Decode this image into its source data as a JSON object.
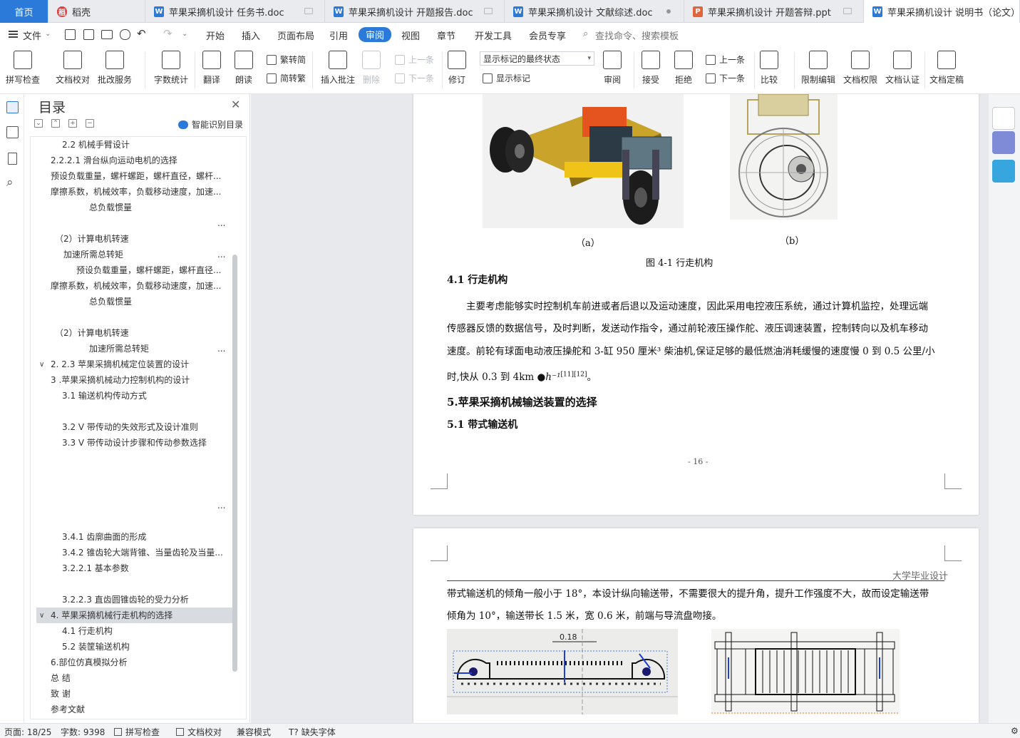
{
  "tabs": [
    {
      "label": "首页",
      "type": "home"
    },
    {
      "label": "稻壳",
      "type": "docer"
    },
    {
      "label": "苹果采摘机设计 任务书.doc",
      "type": "word"
    },
    {
      "label": "苹果采摘机设计 开题报告.doc",
      "type": "word"
    },
    {
      "label": "苹果采摘机设计 文献综述.doc",
      "type": "word"
    },
    {
      "label": "苹果采摘机设计 开题答辩.ppt",
      "type": "ppt"
    },
    {
      "label": "苹果采摘机设计 说明书（论文）",
      "type": "word",
      "active": true
    }
  ],
  "menu": {
    "file": "文件",
    "items": [
      "开始",
      "插入",
      "页面布局",
      "引用",
      "审阅",
      "视图",
      "章节",
      "开发工具",
      "会员专享"
    ],
    "active": "审阅",
    "search_placeholder": "查找命令、搜索模板"
  },
  "ribbon": {
    "spellcheck": "拼写检查",
    "doc_check": "文档校对",
    "batch_service": "批改服务",
    "word_count": "字数统计",
    "translate": "翻译",
    "read_aloud": "朗读",
    "to_traditional": "繁转简",
    "to_simplified": "简转繁",
    "insert_comment": "插入批注",
    "delete": "删除",
    "prev": "上一条",
    "next": "下一条",
    "track": "修订",
    "markup_select": "显示标记的最终状态",
    "show_markup": "显示标记",
    "review": "审阅",
    "accept": "接受",
    "reject": "拒绝",
    "prev2": "上一条",
    "next2": "下一条",
    "compare": "比较",
    "restrict_edit": "限制编辑",
    "doc_permission": "文档权限",
    "doc_cert": "文档认证",
    "doc_final": "文档定稿"
  },
  "toc": {
    "title": "目录",
    "smart": "智能识别目录",
    "items": [
      {
        "text": "2.2 机械手臂设计"
      },
      {
        "text": "2.2.2.1 滑台纵向运动电机的选择"
      },
      {
        "text": "预设负载重量，螺杆螺距，螺杆直径，螺杆..."
      },
      {
        "text": "摩擦系数，机械效率，负载移动速度，加速..."
      },
      {
        "text": "总负载惯量"
      },
      {
        "text": "..."
      },
      {
        "text": "（2）计算电机转速"
      },
      {
        "text": "加速所需总转矩"
      },
      {
        "text": "..."
      },
      {
        "text": "预设负载重量，螺杆螺距，螺杆直径..."
      },
      {
        "text": "摩擦系数，机械效率，负载移动速度，加速..."
      },
      {
        "text": "总负载惯量"
      },
      {
        "text": "（2）计算电机转速"
      },
      {
        "text": "加速所需总转矩"
      },
      {
        "text": "..."
      },
      {
        "text": "2. 2.3 苹果采摘机械定位装置的设计"
      },
      {
        "text": "3 .苹果采摘机械动力控制机构的设计"
      },
      {
        "text": "3.1 输送机构传动方式"
      },
      {
        "text": "3.2 V 带传动的失效形式及设计准则"
      },
      {
        "text": "3.3 V 带传动设计步骤和传动参数选择"
      },
      {
        "text": "..."
      },
      {
        "text": "3.4.1 齿廓曲面的形成"
      },
      {
        "text": "3.4.2 锥齿轮大端背锥、当量齿轮及当量..."
      },
      {
        "text": "3.2.2.1 基本参数"
      },
      {
        "text": "3.2.2.3 直齿圆锥齿轮的受力分析"
      },
      {
        "text": "4. 苹果采摘机械行走机构的选择"
      },
      {
        "text": "4.1 行走机构"
      },
      {
        "text": "5.2 装筐输送机构"
      },
      {
        "text": "6.部位仿真模拟分析"
      },
      {
        "text": "总 结"
      },
      {
        "text": "致 谢"
      },
      {
        "text": "参考文献"
      }
    ]
  },
  "page1": {
    "cap_a": "（a）",
    "cap_b": "（b）",
    "figure_caption": "图 4-1  行走机构",
    "h_41": "4.1 行走机构",
    "p1_l1": "主要考虑能够实时控制机车前进或者后退以及运动速度，因此采用电控液压系统，通过计算机监控，处理远端",
    "p1_l2": "传感器反馈的数据信号，及时判断，发送动作指令，通过前轮液压操作舵、液压调速装置，控制转向以及机车移动",
    "p1_l3": "速度。前轮有球面电动液压操舵和 3-缸 950 厘米³ 柴油机,保证足够的最低燃油消耗缓慢的速度慢 0 到 0.5 公里/小",
    "p1_l4": "时,快从 0.3 到 4km",
    "p1_l4_unit": "h⁻¹",
    "p1_l4_ref": "[11][12]",
    "p1_l4_end": "。",
    "h_5": "5.苹果采摘机械输送装置的选择",
    "h_51": "5.1 带式输送机",
    "page_number": "- 16 -"
  },
  "page2": {
    "header": "大学毕业设计",
    "l1": "带式输送机的倾角一般小于 18°，本设计纵向输送带，不需要很大的提升角，提升工作强度不大，故而设定输送带",
    "l2": "倾角为 10°，输送带长 1.5 米，宽 0.6 米，前端与导流盘吻接。",
    "dim": "0.18"
  },
  "status": {
    "page": "页面: 18/25",
    "words": "字数: 9398",
    "spell": "拼写检查",
    "doc_check": "文档校对",
    "compat": "兼容模式",
    "missing_font": "缺失字体"
  },
  "colors": {
    "accent": "#2b79d8",
    "word_icon": "#2b79d8",
    "ppt_icon": "#e2643d",
    "docer_icon": "#e23b3b"
  }
}
